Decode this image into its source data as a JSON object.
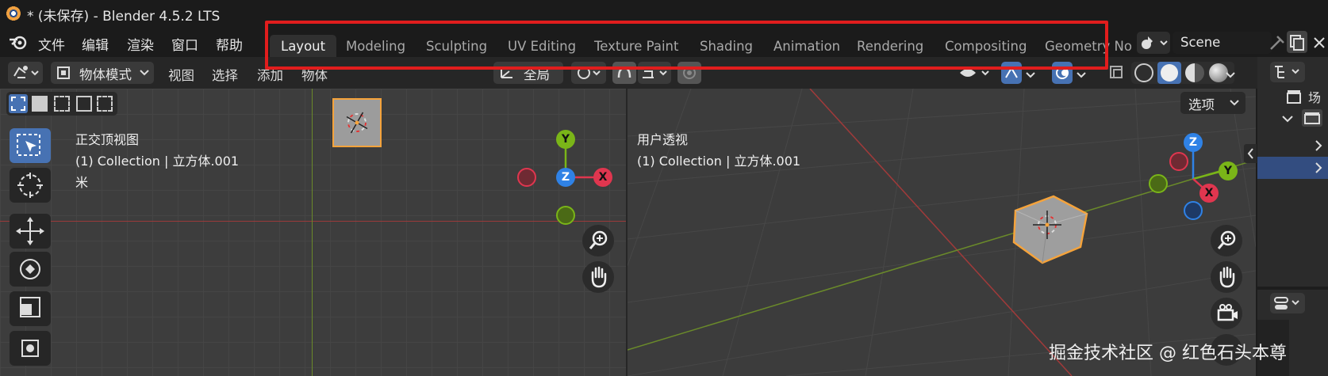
{
  "window": {
    "title": "* (未保存) - Blender 4.5.2 LTS"
  },
  "menu": {
    "items": [
      "文件",
      "编辑",
      "渲染",
      "窗口",
      "帮助"
    ]
  },
  "workspaces": {
    "active": "Layout",
    "tabs": [
      "Layout",
      "Modeling",
      "Sculpting",
      "UV Editing",
      "Texture Paint",
      "Shading",
      "Animation",
      "Rendering",
      "Compositing",
      "Geometry No"
    ]
  },
  "scene": {
    "name": "Scene"
  },
  "header": {
    "mode": "物体模式",
    "menus": [
      "视图",
      "选择",
      "添加",
      "物体"
    ],
    "transform_orientation": "全局",
    "options": "选项"
  },
  "viewport_left": {
    "title": "正交顶视图",
    "collection": "(1) Collection | 立方体.001",
    "unit": "米"
  },
  "viewport_right": {
    "title": "用户透视",
    "collection": "(1) Collection | 立方体.001"
  },
  "gizmo_left": {
    "y": "Y",
    "x": "X",
    "z": "Z"
  },
  "gizmo_right": {
    "z": "Z",
    "y": "Y",
    "x": "X"
  },
  "outliner": {
    "item": "场景"
  },
  "watermark": "掘金技术社区 @ 红色石头本尊",
  "colors": {
    "accent": "#4772b3",
    "highlight": "#e11d1d",
    "x_axis": "#e0364f",
    "y_axis": "#7ab518",
    "z_axis": "#2f82e6"
  }
}
